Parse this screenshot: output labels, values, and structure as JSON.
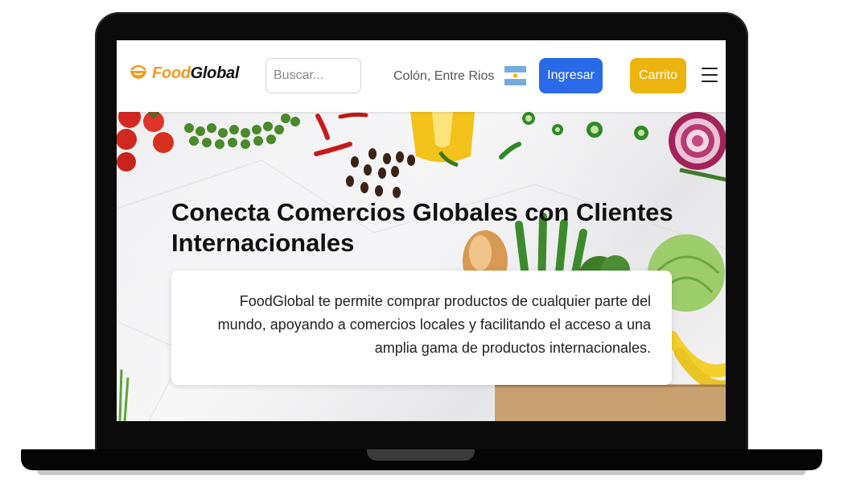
{
  "brand": {
    "name_prefix": "Food",
    "name_suffix": "Global"
  },
  "search": {
    "placeholder": "Buscar..."
  },
  "location": {
    "text": "Colón, Entre Rios"
  },
  "nav": {
    "login_label": "Ingresar",
    "cart_label": "Carrito"
  },
  "hero": {
    "title": "Conecta Comercios Globales con Clientes Internacionales",
    "description": "FoodGlobal te permite comprar productos de cualquier parte del mundo, apoyando a comercios locales y facilitando el acceso a una amplia gama de productos internacionales."
  },
  "icons": {
    "logo": "food-bowl-icon",
    "flag": "argentina-flag-icon",
    "menu": "hamburger-menu-icon"
  },
  "colors": {
    "brand_orange": "#f39a1e",
    "login_button": "#2a6ae8",
    "cart_button": "#ecb40e",
    "laptop_frame": "#0b0b0b"
  }
}
